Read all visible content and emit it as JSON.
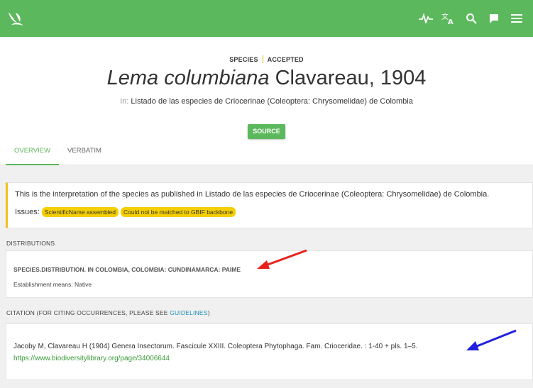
{
  "topbar": {
    "icons": [
      "gbif-logo-icon",
      "activity-icon",
      "translate-icon",
      "search-icon",
      "feedback-icon",
      "menu-icon"
    ]
  },
  "header": {
    "rank": "SPECIES",
    "status": "ACCEPTED",
    "title_italic": "Lema columbiana",
    "title_author": "Clavareau, 1904",
    "in_prefix": "In:",
    "in_dataset": "Listado de las especies de Criocerinae (Coleoptera: Chrysomelidae) de Colombia",
    "source_button": "SOURCE",
    "tabs": [
      {
        "label": "OVERVIEW",
        "active": true
      },
      {
        "label": "VERBATIM",
        "active": false
      }
    ]
  },
  "notice": {
    "text": "This is the interpretation of the species as published in Listado de las especies de Criocerinae (Coleoptera: Chrysomelidae) de Colombia.",
    "issues_label": "Issues:",
    "issues": [
      "ScientificName assembled",
      "Could not be matched to GBIF backbone"
    ]
  },
  "distributions": {
    "label": "DISTRIBUTIONS",
    "title": "SPECIES.DISTRIBUTION. IN COLOMBIA, COLOMBIA: CUNDINAMARCA: PAIME",
    "establishment": "Establishment means: Native"
  },
  "citation": {
    "label_prefix": "CITATION (FOR CITING OCCURRENCES, PLEASE SEE",
    "label_link": "GUIDELINES",
    "label_suffix": ")",
    "text": "Jacoby M, Clavareau H (1904) Genera Insectorum. Fascicule XXIII. Coleoptera Phytophaga. Fam. Crioceridae. : 1-40 + pls. 1–5.",
    "url": "https://www.biodiversitylibrary.org/page/34006644"
  },
  "colors": {
    "brand_green": "#5cb85c",
    "badge_yellow": "#f5cf00",
    "link_blue": "#1a8fb8",
    "annotation_red": "#e8211c",
    "annotation_blue": "#2020e0"
  }
}
